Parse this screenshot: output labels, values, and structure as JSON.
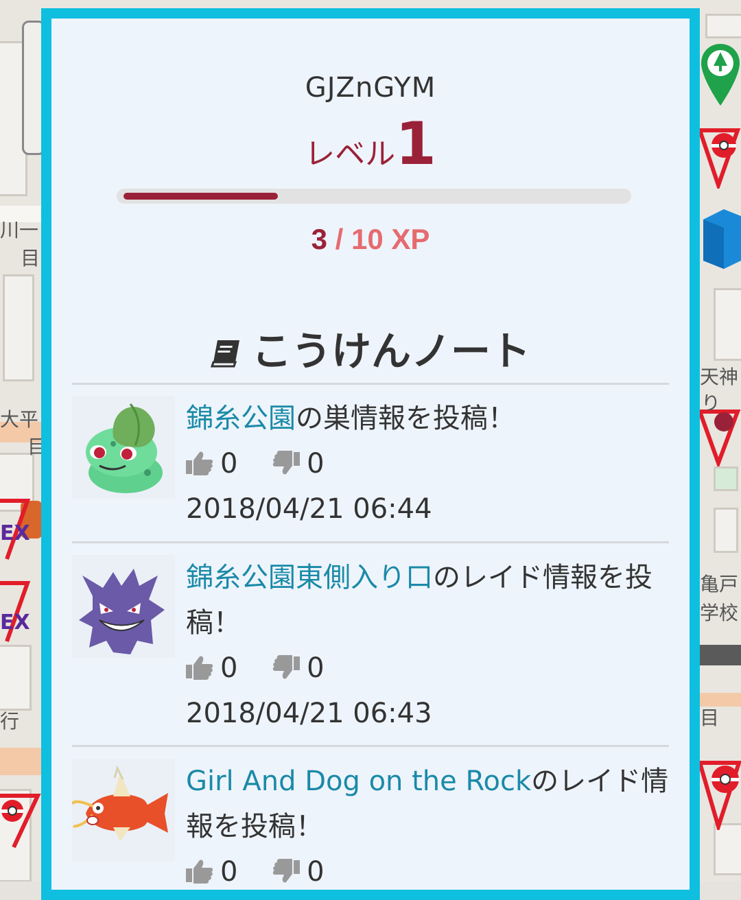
{
  "gym": {
    "name": "GJZnGYM"
  },
  "level": {
    "label": "レベル",
    "value": "1"
  },
  "xp": {
    "current": "3",
    "rest": " / 10 XP",
    "fraction": 0.3
  },
  "notebook": {
    "title": "こうけんノート",
    "icon": "book-icon"
  },
  "entries": [
    {
      "avatar": "bulbasaur-avatar",
      "location": "錦糸公園",
      "action": "の巣情報を投稿！",
      "likes": "0",
      "dislikes": "0",
      "date": "2018/04/21 06:44"
    },
    {
      "avatar": "gengar-avatar",
      "location": "錦糸公園東側入り口",
      "action": "のレイド情報を投稿！",
      "likes": "0",
      "dislikes": "0",
      "date": "2018/04/21 06:43"
    },
    {
      "avatar": "magikarp-avatar",
      "location": "Girl And Dog on the Rock",
      "action": "のレイド情報を投稿！",
      "likes": "0",
      "dislikes": "0",
      "date": ""
    }
  ],
  "map": {
    "labels": [
      "天神",
      "り",
      "大平",
      "目",
      "川一",
      "目",
      "亀戸",
      "学校",
      "EX",
      "EX",
      "行",
      "目"
    ]
  },
  "colors": {
    "accent": "#9a2238",
    "xp_rest": "#e56b6f",
    "link": "#1a8aa8",
    "frame": "#0fbfe0"
  }
}
